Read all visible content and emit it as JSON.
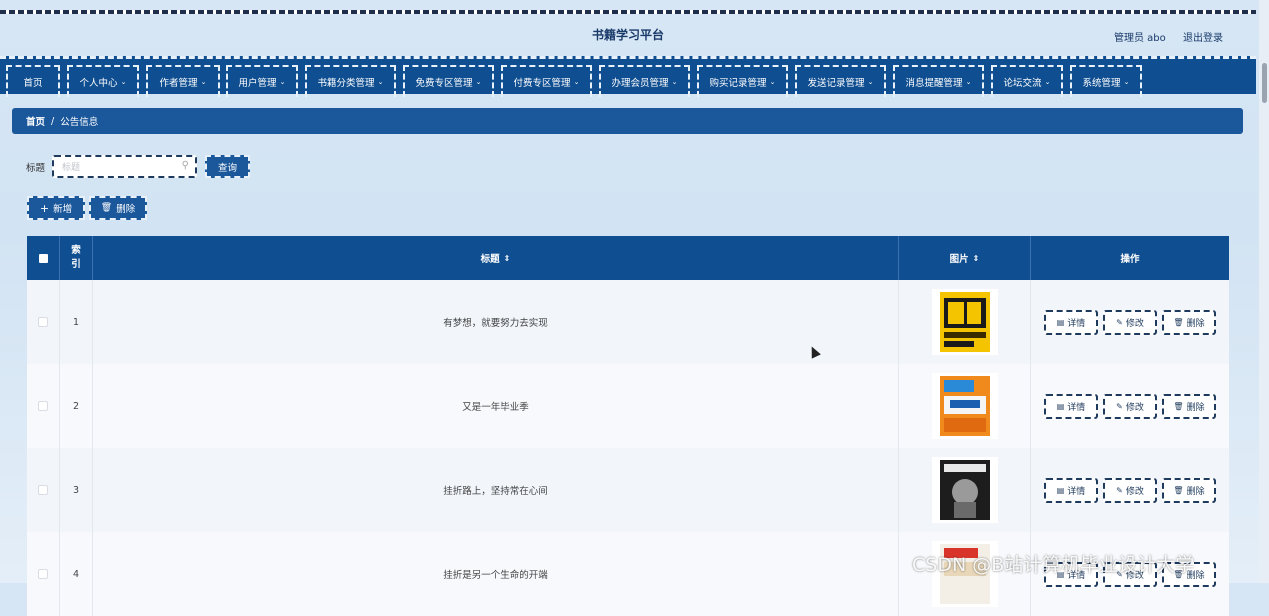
{
  "site": {
    "title": "书籍学习平台",
    "admin": "管理员 abo",
    "logout": "退出登录"
  },
  "nav": [
    {
      "label": "首页"
    },
    {
      "label": "个人中心"
    },
    {
      "label": "作者管理"
    },
    {
      "label": "用户管理"
    },
    {
      "label": "书籍分类管理"
    },
    {
      "label": "免费专区管理"
    },
    {
      "label": "付费专区管理"
    },
    {
      "label": "办理会员管理"
    },
    {
      "label": "购买记录管理"
    },
    {
      "label": "发送记录管理"
    },
    {
      "label": "消息提醒管理"
    },
    {
      "label": "论坛交流"
    },
    {
      "label": "系统管理"
    }
  ],
  "breadcrumb": {
    "home": "首页",
    "sep": "/",
    "current": "公告信息"
  },
  "search": {
    "label": "标题",
    "placeholder": "标题",
    "button": "查询"
  },
  "toolbar": {
    "add": "新增",
    "delete": "删除"
  },
  "table": {
    "headers": {
      "index": "索引",
      "title": "标题",
      "image": "图片",
      "actions": "操作"
    },
    "rows": [
      {
        "index": "1",
        "title": "有梦想，就要努力去实现"
      },
      {
        "index": "2",
        "title": "又是一年毕业季"
      },
      {
        "index": "3",
        "title": "挂折路上，坚持常在心间"
      },
      {
        "index": "4",
        "title": "挂折是另一个生命的开端"
      }
    ],
    "actions": {
      "detail": "详情",
      "edit": "修改",
      "delete": "删除"
    }
  },
  "watermark": "CSDN @B站计算机毕业设计大学"
}
